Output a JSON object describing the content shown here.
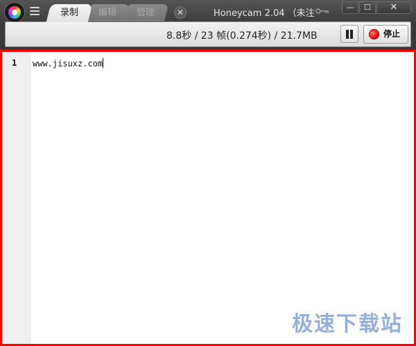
{
  "titlebar": {
    "tabs": [
      {
        "label": "录制",
        "active": true
      },
      {
        "label": "编辑",
        "active": false
      },
      {
        "label": "管理",
        "active": false
      }
    ],
    "app_title": "Honeycam 2.04  （未注",
    "close_tab_icon": "x-circle-icon",
    "window_buttons": {
      "minimize": "—",
      "maximize": "☐",
      "close": "✕"
    }
  },
  "toolbar": {
    "stats": "8.8秒 / 23 帧(0.274秒) / 21.7MB",
    "pause_icon": "pause-icon",
    "stop_label": "停止",
    "record_color": "#ff1b1b"
  },
  "capture": {
    "border_color": "#ff0000",
    "line_number": "1",
    "code_text": "www.jisuxz.com"
  },
  "watermark": "极速下载站"
}
